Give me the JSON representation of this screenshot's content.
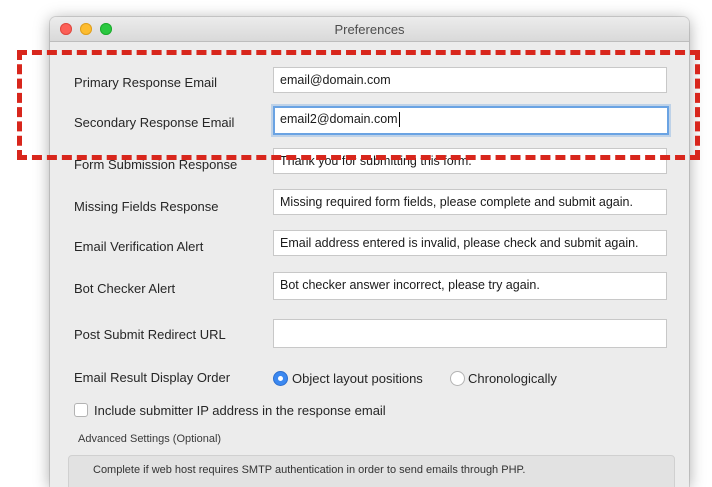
{
  "window": {
    "title": "Preferences"
  },
  "form": {
    "rows": [
      {
        "label": "Primary Response Email",
        "value": "email@domain.com"
      },
      {
        "label": "Secondary Response Email",
        "value": "email2@domain.com"
      },
      {
        "label": "Form Submission Response",
        "value": "Thank you for submitting this form."
      },
      {
        "label": "Missing Fields Response",
        "value": "Missing required form fields, please complete and submit again."
      },
      {
        "label": "Email Verification Alert",
        "value": "Email address entered is invalid, please check and submit again."
      },
      {
        "label": "Bot Checker Alert",
        "value": "Bot checker answer incorrect, please try again."
      },
      {
        "label": "Post Submit Redirect URL",
        "value": ""
      }
    ],
    "display_order": {
      "label": "Email Result Display Order",
      "options": [
        "Object layout positions",
        "Chronologically"
      ],
      "selected": "Object layout positions"
    },
    "include_ip": {
      "label": "Include submitter IP address in the response email",
      "checked": false
    },
    "advanced": {
      "title": "Advanced Settings (Optional)",
      "description": "Complete if web host requires SMTP authentication in order to send emails through PHP."
    }
  },
  "colors": {
    "highlight": "#d8261c",
    "radio_selected": "#3b88f0",
    "focus_ring": "#6aa3e3"
  }
}
